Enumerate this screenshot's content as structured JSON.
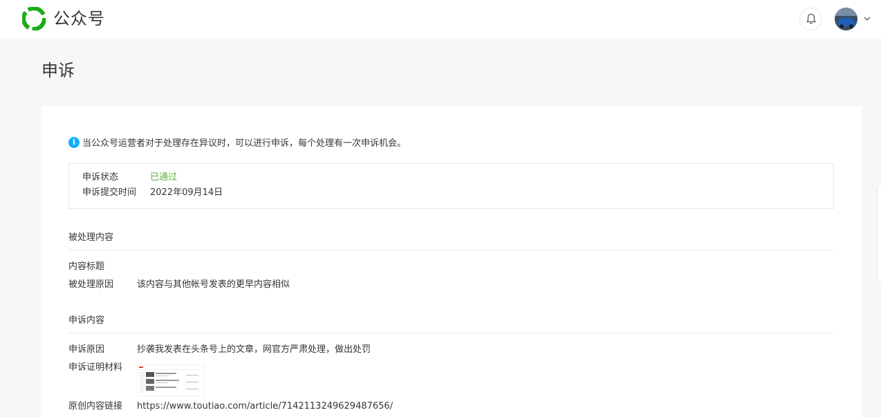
{
  "header": {
    "brand": "公众号",
    "brand_colors": {
      "green": "#07c160",
      "dark_green": "#1aad19"
    },
    "icons": [
      "wechat-mp-logo-icon",
      "bell-icon",
      "chevron-down-icon"
    ]
  },
  "page": {
    "title": "申诉"
  },
  "notice": {
    "text": "当公众号运营者对于处理存在异议时，可以进行申诉，每个处理有一次申诉机会。",
    "icon": "info-icon",
    "icon_color": "#10aeff"
  },
  "status": {
    "status_label": "申诉状态",
    "status_value": "已通过",
    "status_color": "#5eaf3e",
    "submit_time_label": "申诉提交时间",
    "submit_time_value": "2022年09月14日"
  },
  "processed": {
    "heading": "被处理内容",
    "content_title_label": "内容标题",
    "reason_label": "被处理原因",
    "reason_value": "该内容与其他帐号发表的更早内容相似"
  },
  "appeal": {
    "heading": "申诉内容",
    "reason_label": "申诉原因",
    "reason_value": "抄袭我发表在头条号上的文章，网官方严肃处理，做出处罚",
    "proof_label": "申诉证明材料",
    "original_link_label": "原创内容链接",
    "original_link_value": "https://www.toutiao.com/article/7142113249629487656/"
  }
}
